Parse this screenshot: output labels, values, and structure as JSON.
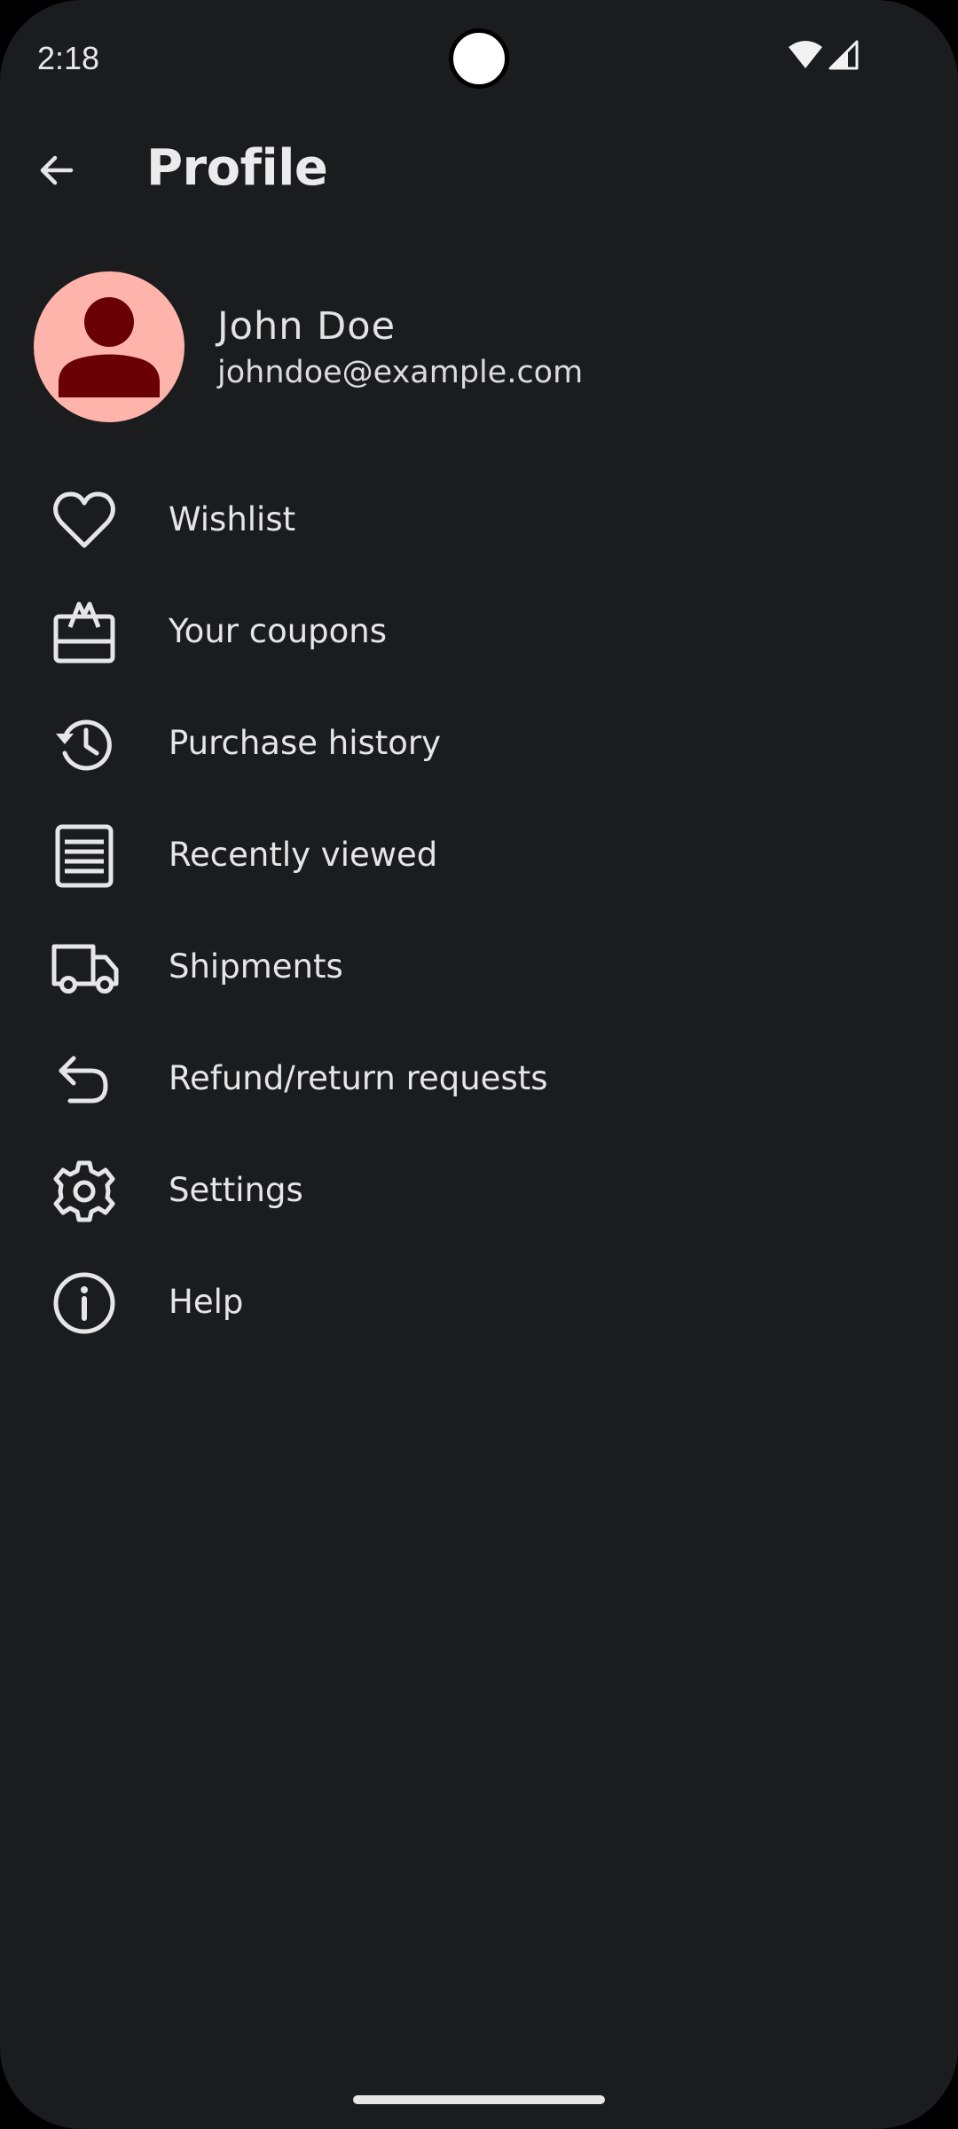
{
  "status_bar": {
    "time": "2:18",
    "icons": [
      "wifi-icon",
      "cell-signal-icon"
    ]
  },
  "app_bar": {
    "back_icon": "arrow-back-icon",
    "title": "Profile"
  },
  "profile": {
    "avatar_icon": "person-icon",
    "name": "John Doe",
    "email": "johndoe@example.com"
  },
  "menu": {
    "items": [
      {
        "label": "Wishlist",
        "icon": "heart-icon"
      },
      {
        "label": "Your coupons",
        "icon": "gift-card-icon"
      },
      {
        "label": "Purchase history",
        "icon": "history-icon"
      },
      {
        "label": "Recently viewed",
        "icon": "list-icon"
      },
      {
        "label": "Shipments",
        "icon": "truck-icon"
      },
      {
        "label": "Refund/return requests",
        "icon": "undo-icon"
      },
      {
        "label": "Settings",
        "icon": "gear-icon"
      },
      {
        "label": "Help",
        "icon": "info-icon"
      }
    ]
  },
  "colors": {
    "background": "#1b1c1e",
    "text": "#e6e6e6",
    "avatar_background": "#ffb4ab",
    "avatar_foreground": "#690005"
  }
}
